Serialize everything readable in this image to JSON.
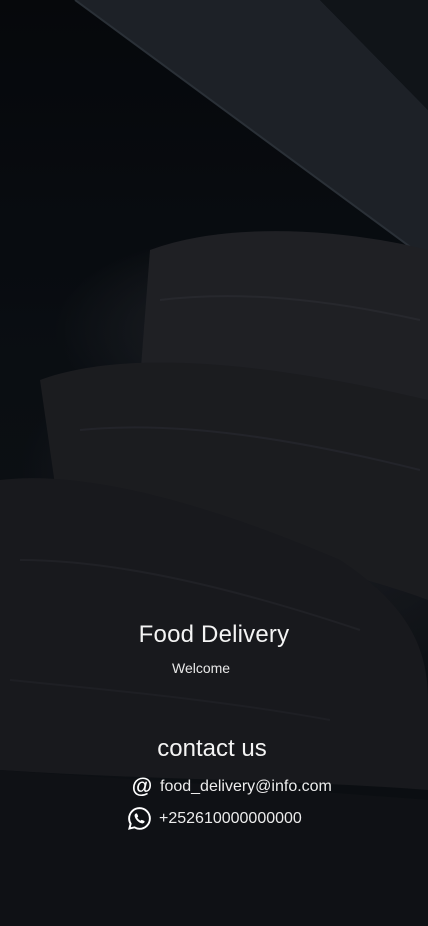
{
  "app": {
    "title": "Food Delivery",
    "subtitle": "Welcome"
  },
  "contact": {
    "heading": "contact us",
    "email": "food_delivery@info.com",
    "phone": "+252610000000000"
  },
  "icons": {
    "email": "at-icon",
    "phone": "whatsapp-icon"
  },
  "colors": {
    "text": "#ffffff",
    "background": "#0d1116"
  }
}
